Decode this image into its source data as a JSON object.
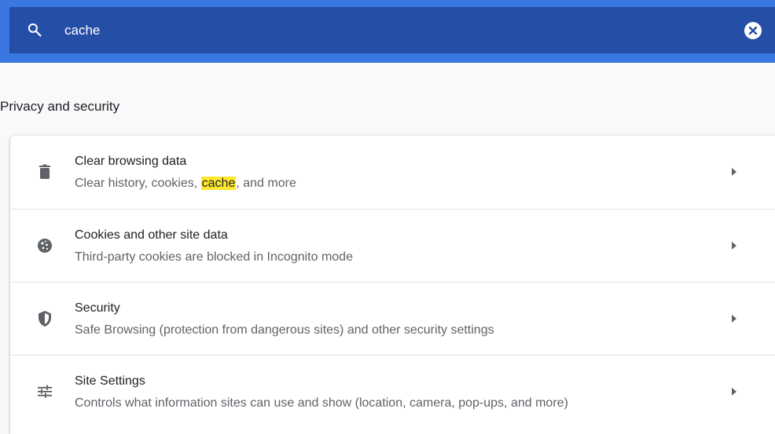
{
  "search": {
    "query": "cache",
    "placeholder": "Search settings",
    "clear_label": "Clear search"
  },
  "colors": {
    "top_accent": "#3a77e0",
    "search_bar": "#254ea6",
    "highlight": "#ffe82b"
  },
  "section": {
    "title": "Privacy and security"
  },
  "items": [
    {
      "title": "Clear browsing data",
      "subtitle_before": "Clear history, cookies, ",
      "subtitle_match": "cache",
      "subtitle_after": ", and more",
      "icon": "trash-icon"
    },
    {
      "title": "Cookies and other site data",
      "subtitle": "Third-party cookies are blocked in Incognito mode",
      "icon": "cookie-icon"
    },
    {
      "title": "Security",
      "subtitle": "Safe Browsing (protection from dangerous sites) and other security settings",
      "icon": "shield-icon"
    },
    {
      "title": "Site Settings",
      "subtitle": "Controls what information sites can use and show (location, camera, pop-ups, and more)",
      "icon": "tune-icon"
    }
  ]
}
